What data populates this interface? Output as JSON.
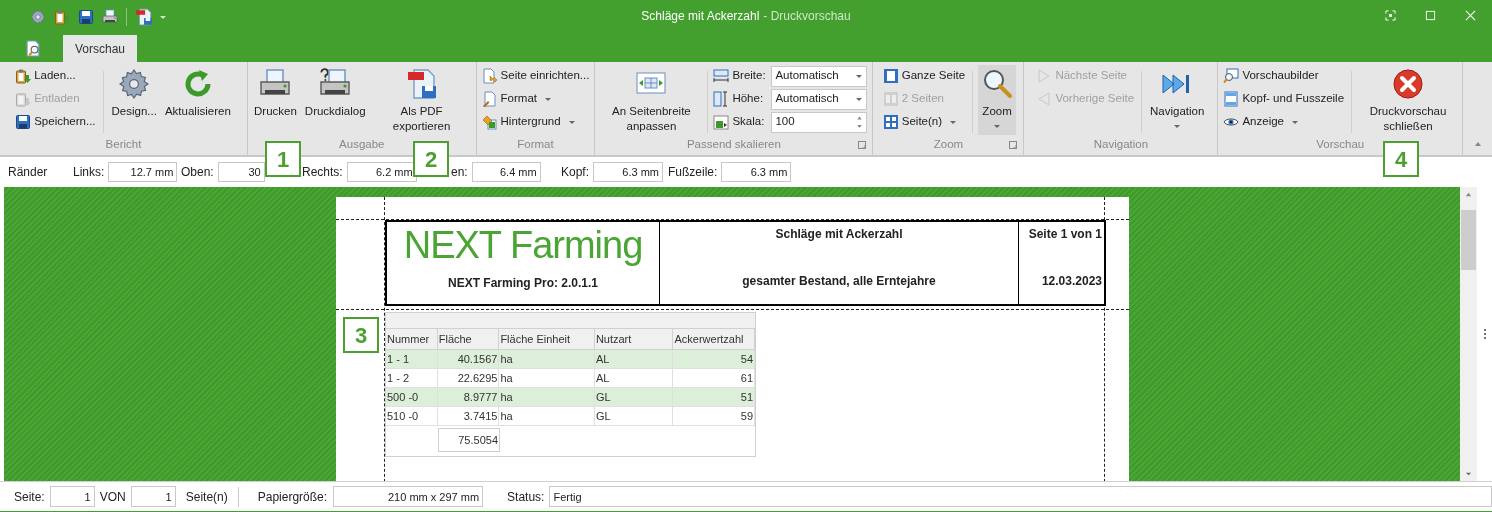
{
  "window": {
    "title": "Schläge mit Ackerzahl",
    "subtitle": "- Druckvorschau"
  },
  "tabs": [
    {
      "label": "Vorschau",
      "selected": true
    }
  ],
  "ribbon": {
    "groups": [
      {
        "title": "Bericht",
        "launcher": false,
        "items": [
          {
            "kind": "stack",
            "items": [
              {
                "label": "Laden...",
                "disabled": false,
                "dropdown": false
              },
              {
                "label": "Entladen",
                "disabled": true,
                "dropdown": false
              },
              {
                "label": "Speichern...",
                "disabled": false,
                "dropdown": false
              }
            ]
          },
          {
            "kind": "separator"
          },
          {
            "kind": "large",
            "label": "Design...",
            "disabled": false,
            "dropdown": false
          },
          {
            "kind": "large",
            "label": "Aktualisieren",
            "disabled": false,
            "dropdown": false
          }
        ]
      },
      {
        "title": "Ausgabe",
        "launcher": false,
        "items": [
          {
            "kind": "large",
            "label": "Drucken",
            "disabled": false,
            "dropdown": false
          },
          {
            "kind": "large",
            "label": "Druckdialog",
            "disabled": false,
            "dropdown": false
          },
          {
            "kind": "large",
            "label": "Als PDF exportieren",
            "disabled": false,
            "dropdown": false
          }
        ]
      },
      {
        "title": "Format",
        "launcher": false,
        "items": [
          {
            "kind": "stack",
            "items": [
              {
                "label": "Seite einrichten...",
                "disabled": false,
                "dropdown": false
              },
              {
                "label": "Format",
                "disabled": false,
                "dropdown": true
              },
              {
                "label": "Hintergrund",
                "disabled": false,
                "dropdown": true
              }
            ]
          }
        ]
      },
      {
        "title": "Passend skalieren",
        "launcher": true,
        "items": [
          {
            "kind": "large",
            "label": "An Seitenbreite anpassen",
            "disabled": false,
            "dropdown": false
          },
          {
            "kind": "separator"
          },
          {
            "kind": "fields",
            "items": [
              {
                "label": "Breite:",
                "value": "Automatisch",
                "kind": "combo"
              },
              {
                "label": "Höhe:",
                "value": "Automatisch",
                "kind": "combo"
              },
              {
                "label": "Skala:",
                "value": "100",
                "kind": "spin"
              }
            ]
          }
        ]
      },
      {
        "title": "Zoom",
        "launcher": true,
        "items": [
          {
            "kind": "stack",
            "items": [
              {
                "label": "Ganze Seite",
                "disabled": false,
                "dropdown": false
              },
              {
                "label": "2 Seiten",
                "disabled": true,
                "dropdown": false
              },
              {
                "label": "Seite(n)",
                "disabled": false,
                "dropdown": true
              }
            ]
          },
          {
            "kind": "separator"
          },
          {
            "kind": "large",
            "label": "Zoom",
            "disabled": false,
            "dropdown": true
          }
        ]
      },
      {
        "title": "Navigation",
        "launcher": false,
        "items": [
          {
            "kind": "stack",
            "items": [
              {
                "label": "Nächste Seite",
                "disabled": true,
                "dropdown": false
              },
              {
                "label": "Vorherige Seite",
                "disabled": true,
                "dropdown": false
              }
            ]
          },
          {
            "kind": "separator"
          },
          {
            "kind": "large",
            "label": "Navigation",
            "disabled": false,
            "dropdown": true
          }
        ]
      },
      {
        "title": "Vorschau",
        "launcher": false,
        "items": [
          {
            "kind": "stack",
            "items": [
              {
                "label": "Vorschaubilder",
                "disabled": false,
                "dropdown": false
              },
              {
                "label": "Kopf- und Fusszeile",
                "disabled": false,
                "dropdown": false
              },
              {
                "label": "Anzeige",
                "disabled": false,
                "dropdown": true
              }
            ]
          },
          {
            "kind": "separator"
          },
          {
            "kind": "large",
            "label": "Druckvorschau schließen",
            "disabled": false,
            "dropdown": false
          }
        ]
      }
    ]
  },
  "margins": {
    "label": "Ränder",
    "fields": [
      {
        "label": "Links:",
        "value": "12.7 mm"
      },
      {
        "label": "Oben:",
        "value": "30"
      },
      {
        "label": "Rechts:",
        "value": "6.2 mm"
      },
      {
        "label": "en:",
        "value": "6.4 mm"
      },
      {
        "label": "Kopf:",
        "value": "6.3 mm"
      },
      {
        "label": "Fußzeile:",
        "value": "6.3 mm"
      }
    ]
  },
  "report": {
    "logo": "NEXT Farming",
    "version": "NEXT Farming Pro: 2.0.1.1",
    "title": "Schläge mit Ackerzahl",
    "subtitle": "gesamter Bestand, alle Erntejahre",
    "page": "Seite 1 von 1",
    "date": "12.03.2023",
    "table": {
      "columns": [
        "Nummer",
        "Fläche",
        "Fläche Einheit",
        "Nutzart",
        "Ackerwertzahl"
      ],
      "rows": [
        [
          "1 - 1",
          "40.1567",
          "ha",
          "AL",
          "54"
        ],
        [
          "1 - 2",
          "22.6295",
          "ha",
          "AL",
          "61"
        ],
        [
          "500 -0",
          "8.9777",
          "ha",
          "GL",
          "51"
        ],
        [
          "510 -0",
          "3.7415",
          "ha",
          "GL",
          "59"
        ]
      ],
      "total": "75.5054"
    }
  },
  "status_bar": {
    "page_label": "Seite:",
    "page": "1",
    "of_label": "VON",
    "pages": "1",
    "pages_label": "Seite(n)",
    "paper_label": "Papiergröße:",
    "paper": "210 mm x 297 mm",
    "status_label": "Status:",
    "status": "Fertig"
  },
  "callouts": [
    {
      "label": "1"
    },
    {
      "label": "2"
    },
    {
      "label": "3"
    },
    {
      "label": "4"
    }
  ]
}
